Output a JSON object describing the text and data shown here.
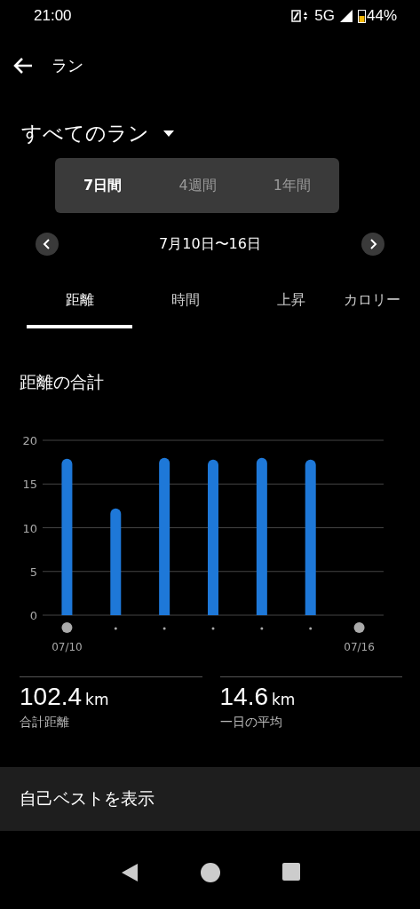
{
  "status_bar": {
    "time": "21:00",
    "network": "5G",
    "battery": "44%"
  },
  "header": {
    "title": "ラン"
  },
  "filter": {
    "label": "すべてのラン"
  },
  "periods": [
    {
      "label": "7日間",
      "selected": true
    },
    {
      "label": "4週間",
      "selected": false
    },
    {
      "label": "1年間",
      "selected": false
    }
  ],
  "date_range": "7月10日〜16日",
  "metric_tabs": [
    {
      "label": "距離",
      "selected": true
    },
    {
      "label": "時間",
      "selected": false
    },
    {
      "label": "上昇",
      "selected": false
    },
    {
      "label": "カロリー",
      "selected": false
    }
  ],
  "chart_title": "距離の合計",
  "chart": {
    "chart_data": {
      "type": "bar",
      "categories": [
        "07/10",
        null,
        null,
        null,
        null,
        null,
        "07/16"
      ],
      "series": [
        {
          "color": "#1e78d8",
          "values": [
            17.9,
            12.2,
            18.0,
            17.8,
            18.0,
            17.8,
            null
          ]
        }
      ],
      "ylim": [
        0,
        20
      ],
      "yticks": [
        0,
        5,
        10,
        15,
        20
      ],
      "grid": true
    }
  },
  "stats": [
    {
      "value": "102.4",
      "unit": "km",
      "label": "合計距離"
    },
    {
      "value": "14.6",
      "unit": "km",
      "label": "一日の平均"
    }
  ],
  "best_button": "自己ベストを表示"
}
